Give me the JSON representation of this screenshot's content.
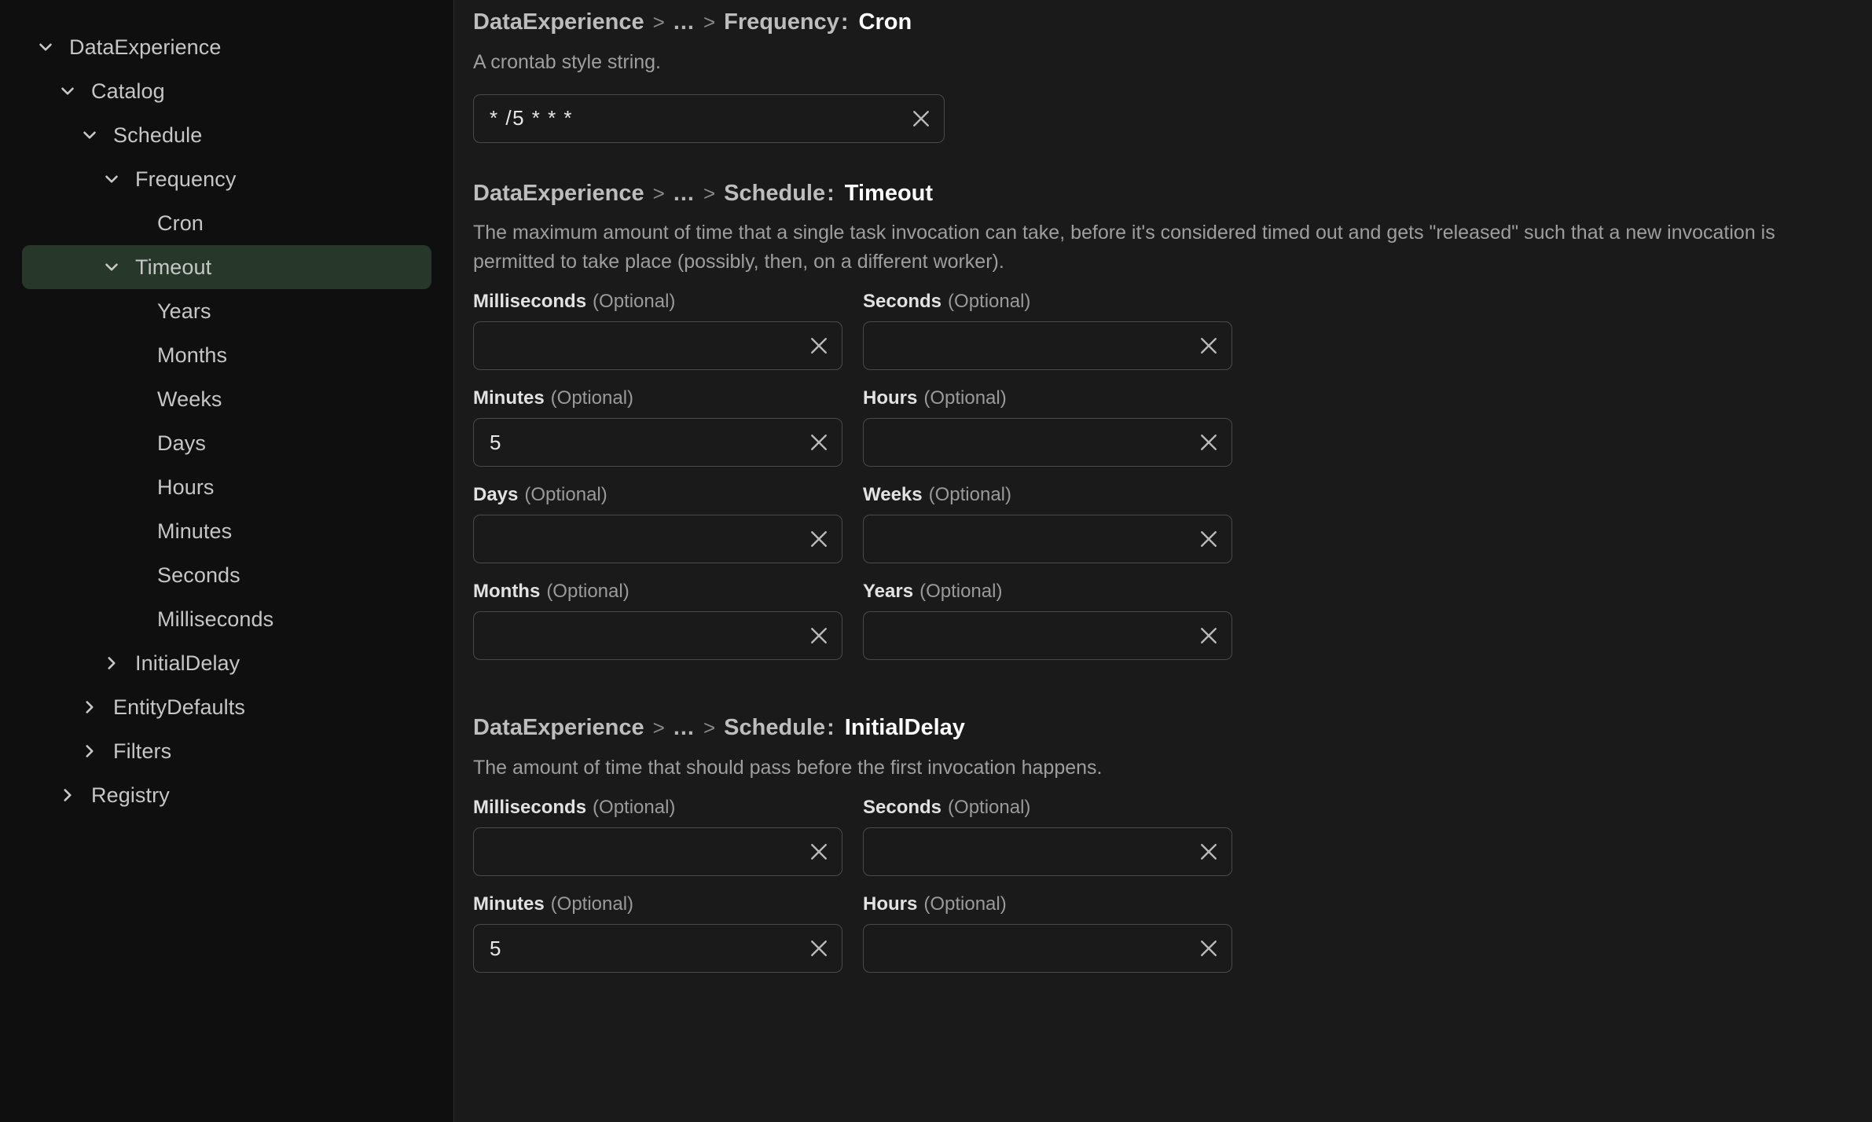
{
  "sidebar": {
    "items": [
      {
        "label": "DataExperience",
        "indent": 0,
        "icon": "chevron-down-icon",
        "expanded": true,
        "selected": false
      },
      {
        "label": "Catalog",
        "indent": 1,
        "icon": "chevron-down-icon",
        "expanded": true,
        "selected": false
      },
      {
        "label": "Schedule",
        "indent": 2,
        "icon": "chevron-down-icon",
        "expanded": true,
        "selected": false
      },
      {
        "label": "Frequency",
        "indent": 3,
        "icon": "chevron-down-icon",
        "expanded": true,
        "selected": false
      },
      {
        "label": "Cron",
        "indent": 4,
        "icon": "none",
        "expanded": false,
        "selected": false
      },
      {
        "label": "Timeout",
        "indent": 3,
        "icon": "chevron-down-icon",
        "expanded": true,
        "selected": true
      },
      {
        "label": "Years",
        "indent": 4,
        "icon": "none",
        "expanded": false,
        "selected": false
      },
      {
        "label": "Months",
        "indent": 4,
        "icon": "none",
        "expanded": false,
        "selected": false
      },
      {
        "label": "Weeks",
        "indent": 4,
        "icon": "none",
        "expanded": false,
        "selected": false
      },
      {
        "label": "Days",
        "indent": 4,
        "icon": "none",
        "expanded": false,
        "selected": false
      },
      {
        "label": "Hours",
        "indent": 4,
        "icon": "none",
        "expanded": false,
        "selected": false
      },
      {
        "label": "Minutes",
        "indent": 4,
        "icon": "none",
        "expanded": false,
        "selected": false
      },
      {
        "label": "Seconds",
        "indent": 4,
        "icon": "none",
        "expanded": false,
        "selected": false
      },
      {
        "label": "Milliseconds",
        "indent": 4,
        "icon": "none",
        "expanded": false,
        "selected": false
      },
      {
        "label": "InitialDelay",
        "indent": 3,
        "icon": "chevron-right-icon",
        "expanded": false,
        "selected": false
      },
      {
        "label": "EntityDefaults",
        "indent": 2,
        "icon": "chevron-right-icon",
        "expanded": false,
        "selected": false
      },
      {
        "label": "Filters",
        "indent": 2,
        "icon": "chevron-right-icon",
        "expanded": false,
        "selected": false
      },
      {
        "label": "Registry",
        "indent": 1,
        "icon": "chevron-right-icon",
        "expanded": false,
        "selected": false
      }
    ],
    "selected_bg": "#27382a"
  },
  "main": {
    "sections": [
      {
        "breadcrumb": {
          "root": "DataExperience",
          "ellipsis": "...",
          "parent": "Frequency",
          "separator": ">",
          "colon": ":"
        },
        "leaf": "Cron",
        "description": "A crontab style string.",
        "layout": "single",
        "fields": [
          {
            "label": "Cron",
            "optional": "",
            "value": "* /5 * * *",
            "placeholder": "",
            "clear_icon": "close-icon"
          }
        ]
      },
      {
        "breadcrumb": {
          "root": "DataExperience",
          "ellipsis": "...",
          "parent": "Schedule",
          "separator": ">",
          "colon": ":"
        },
        "leaf": "Timeout",
        "description": "The maximum amount of time that a single task invocation can take, before it's considered timed out and gets \"released\" such that a new invocation is permitted to take place (possibly, then, on a different worker).",
        "layout": "grid",
        "fields": [
          {
            "label": "Milliseconds",
            "optional": "(Optional)",
            "value": "",
            "placeholder": "",
            "clear_icon": "close-icon"
          },
          {
            "label": "Seconds",
            "optional": "(Optional)",
            "value": "",
            "placeholder": "",
            "clear_icon": "close-icon"
          },
          {
            "label": "Minutes",
            "optional": "(Optional)",
            "value": "5",
            "placeholder": "",
            "clear_icon": "close-icon"
          },
          {
            "label": "Hours",
            "optional": "(Optional)",
            "value": "",
            "placeholder": "",
            "clear_icon": "close-icon"
          },
          {
            "label": "Days",
            "optional": "(Optional)",
            "value": "",
            "placeholder": "",
            "clear_icon": "close-icon"
          },
          {
            "label": "Weeks",
            "optional": "(Optional)",
            "value": "",
            "placeholder": "",
            "clear_icon": "close-icon"
          },
          {
            "label": "Months",
            "optional": "(Optional)",
            "value": "",
            "placeholder": "",
            "clear_icon": "close-icon"
          },
          {
            "label": "Years",
            "optional": "(Optional)",
            "value": "",
            "placeholder": "",
            "clear_icon": "close-icon"
          }
        ]
      },
      {
        "breadcrumb": {
          "root": "DataExperience",
          "ellipsis": "...",
          "parent": "Schedule",
          "separator": ">",
          "colon": ":"
        },
        "leaf": "InitialDelay",
        "description": "The amount of time that should pass before the first invocation happens.",
        "layout": "grid",
        "fields": [
          {
            "label": "Milliseconds",
            "optional": "(Optional)",
            "value": "",
            "placeholder": "",
            "clear_icon": "close-icon"
          },
          {
            "label": "Seconds",
            "optional": "(Optional)",
            "value": "",
            "placeholder": "",
            "clear_icon": "close-icon"
          },
          {
            "label": "Minutes",
            "optional": "(Optional)",
            "value": "5",
            "placeholder": "",
            "clear_icon": "close-icon"
          },
          {
            "label": "Hours",
            "optional": "(Optional)",
            "value": "",
            "placeholder": "",
            "clear_icon": "close-icon"
          }
        ]
      }
    ]
  },
  "theme": {
    "sidebar_bg": "#0f0f0f",
    "main_bg": "#1a1a1a",
    "accent_selected": "#27382a",
    "text_primary": "#e8e8e8",
    "text_muted": "#9e9e9e",
    "input_border": "#4a4a4a"
  }
}
